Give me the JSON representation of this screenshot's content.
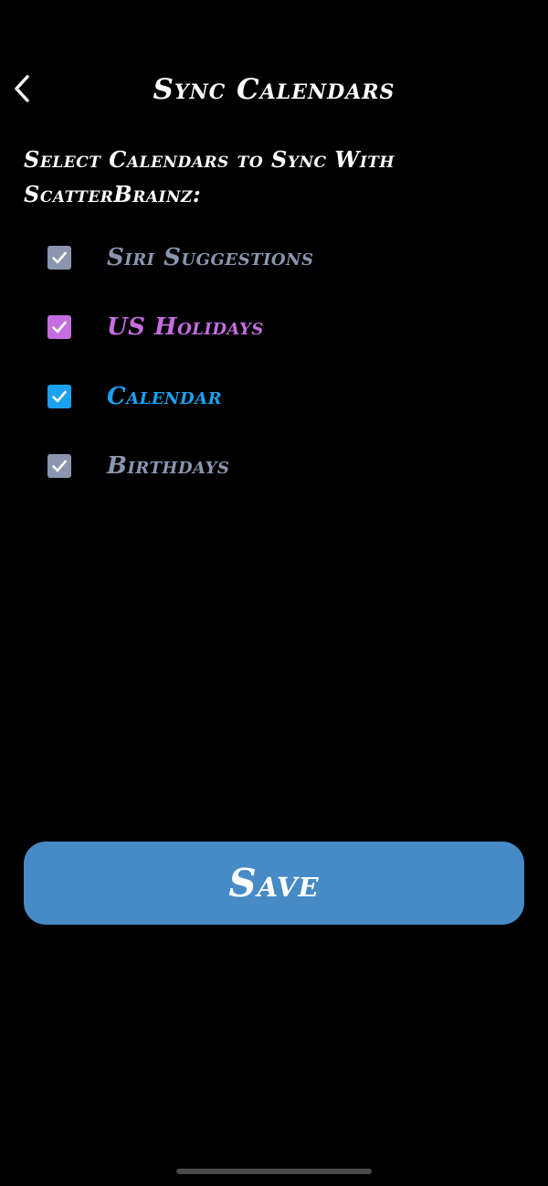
{
  "header": {
    "title": "Sync Calendars",
    "back_icon": "chevron-left-icon"
  },
  "instructions": {
    "line1": "Select Calendars to Sync With",
    "line2": "ScatterBrainz:"
  },
  "calendars": [
    {
      "label": "Siri Suggestions",
      "checked": true,
      "color": "#8a96b0"
    },
    {
      "label": "US Holidays",
      "checked": true,
      "color": "#c46ee0"
    },
    {
      "label": "Calendar",
      "checked": true,
      "color": "#1ba1f2"
    },
    {
      "label": "Birthdays",
      "checked": true,
      "color": "#8a96b0"
    }
  ],
  "actions": {
    "save_label": "Save"
  },
  "colors": {
    "background": "#000000",
    "save_button": "#468ac6",
    "text": "#ffffff"
  }
}
